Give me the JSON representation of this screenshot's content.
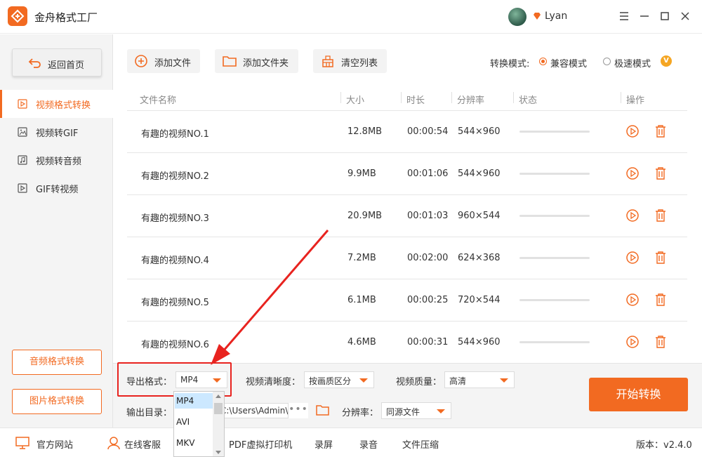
{
  "app": {
    "title": "金舟格式工厂",
    "username": "Lyan",
    "brand_color": "#f26a21"
  },
  "window_controls": [
    "menu-icon",
    "minimize-icon",
    "maximize-icon",
    "close-icon"
  ],
  "sidebar": {
    "back_label": "返回首页",
    "items": [
      {
        "label": "视频格式转换",
        "icon": "video-file-icon",
        "active": true
      },
      {
        "label": "视频转GIF",
        "icon": "image-icon",
        "active": false
      },
      {
        "label": "视频转音频",
        "icon": "music-file-icon",
        "active": false
      },
      {
        "label": "GIF转视频",
        "icon": "video-file-icon",
        "active": false
      }
    ],
    "audio_btn": "音频格式转换",
    "image_btn": "图片格式转换"
  },
  "toolbar": {
    "add_file": "添加文件",
    "add_folder": "添加文件夹",
    "clear_list": "清空列表",
    "mode_label": "转换模式:",
    "mode_compat": "兼容模式",
    "mode_fast": "极速模式",
    "vip_badge": "V"
  },
  "table": {
    "headers": [
      "文件名称",
      "大小",
      "时长",
      "分辨率",
      "状态",
      "操作"
    ],
    "rows": [
      {
        "name": "有趣的视频NO.1",
        "size": "12.8MB",
        "duration": "00:00:54",
        "resolution": "544×960"
      },
      {
        "name": "有趣的视频NO.2",
        "size": "9.9MB",
        "duration": "00:01:06",
        "resolution": "544×960"
      },
      {
        "name": "有趣的视频NO.3",
        "size": "20.9MB",
        "duration": "00:01:03",
        "resolution": "960×544"
      },
      {
        "name": "有趣的视频NO.4",
        "size": "7.2MB",
        "duration": "00:02:00",
        "resolution": "624×368"
      },
      {
        "name": "有趣的视频NO.5",
        "size": "6.1MB",
        "duration": "00:00:25",
        "resolution": "720×544"
      },
      {
        "name": "有趣的视频NO.6",
        "size": "4.6MB",
        "duration": "00:00:31",
        "resolution": "544×960"
      }
    ]
  },
  "settings": {
    "export_format_label": "导出格式：",
    "export_format_value": "MP4",
    "clarity_label": "视频清晰度：",
    "clarity_value": "按画质区分",
    "quality_label": "视频质量：",
    "quality_value": "高清",
    "output_dir_label": "输出目录：",
    "output_dir_value": "C:\\Users\\Admin\\Desktop\\",
    "resolution_label": "分辨率：",
    "resolution_value": "同源文件",
    "start_button": "开始转换",
    "dropdown_options": [
      "MP4",
      "AVI",
      "MKV"
    ]
  },
  "footer": {
    "website": "官方网站",
    "support": "在线客服",
    "pdf_printer": "PDF虚拟打印机",
    "record_screen": "录屏",
    "record_audio": "录音",
    "compress": "文件压缩",
    "version": "版本：v2.4.0"
  },
  "annotation_color": "#e8231f"
}
